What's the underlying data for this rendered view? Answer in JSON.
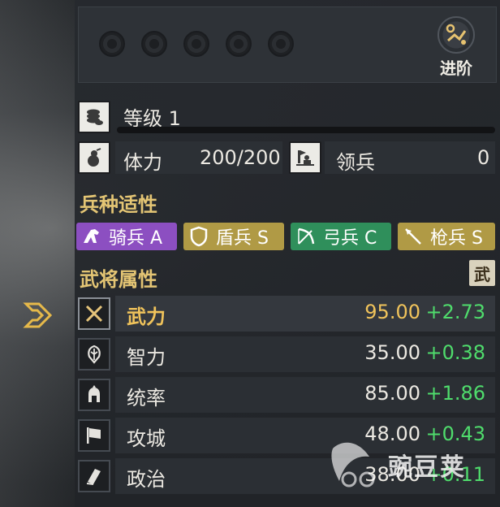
{
  "advance": {
    "label": "进阶",
    "icon": "advance-icon"
  },
  "stars": {
    "count": 5,
    "filled": 0
  },
  "level": {
    "label": "等级 1",
    "progress": 0.0
  },
  "stamina": {
    "label": "体力",
    "value": "200/200"
  },
  "troops": {
    "label": "领兵",
    "value": "0"
  },
  "unit_aptitude": {
    "title": "兵种适性",
    "items": [
      {
        "label": "骑兵 A",
        "color": "#8c4fc1",
        "icon": "cavalry-icon"
      },
      {
        "label": "盾兵 S",
        "color": "#b09a45",
        "icon": "shield-icon"
      },
      {
        "label": "弓兵 C",
        "color": "#2f8f5b",
        "icon": "bow-icon"
      },
      {
        "label": "枪兵 S",
        "color": "#b09a45",
        "icon": "spear-icon"
      }
    ]
  },
  "attributes": {
    "title": "武将属性",
    "tab_label": "武",
    "rows": [
      {
        "name": "武力",
        "value": "95.00",
        "bonus": "+2.73",
        "icon": "crossed-swords-icon",
        "active": true
      },
      {
        "name": "智力",
        "value": "35.00",
        "bonus": "+0.38",
        "icon": "brain-icon",
        "active": false
      },
      {
        "name": "统率",
        "value": "85.00",
        "bonus": "+1.86",
        "icon": "helmet-icon",
        "active": false
      },
      {
        "name": "攻城",
        "value": "48.00",
        "bonus": "+0.43",
        "icon": "flag-icon",
        "active": false
      },
      {
        "name": "政治",
        "value": "38.00",
        "bonus": "+0.11",
        "icon": "scroll-icon",
        "active": false
      }
    ]
  },
  "watermark": {
    "text": "豌豆荚"
  },
  "colors": {
    "accent_gold": "#e4c574",
    "bonus_green": "#4fdc6c"
  }
}
